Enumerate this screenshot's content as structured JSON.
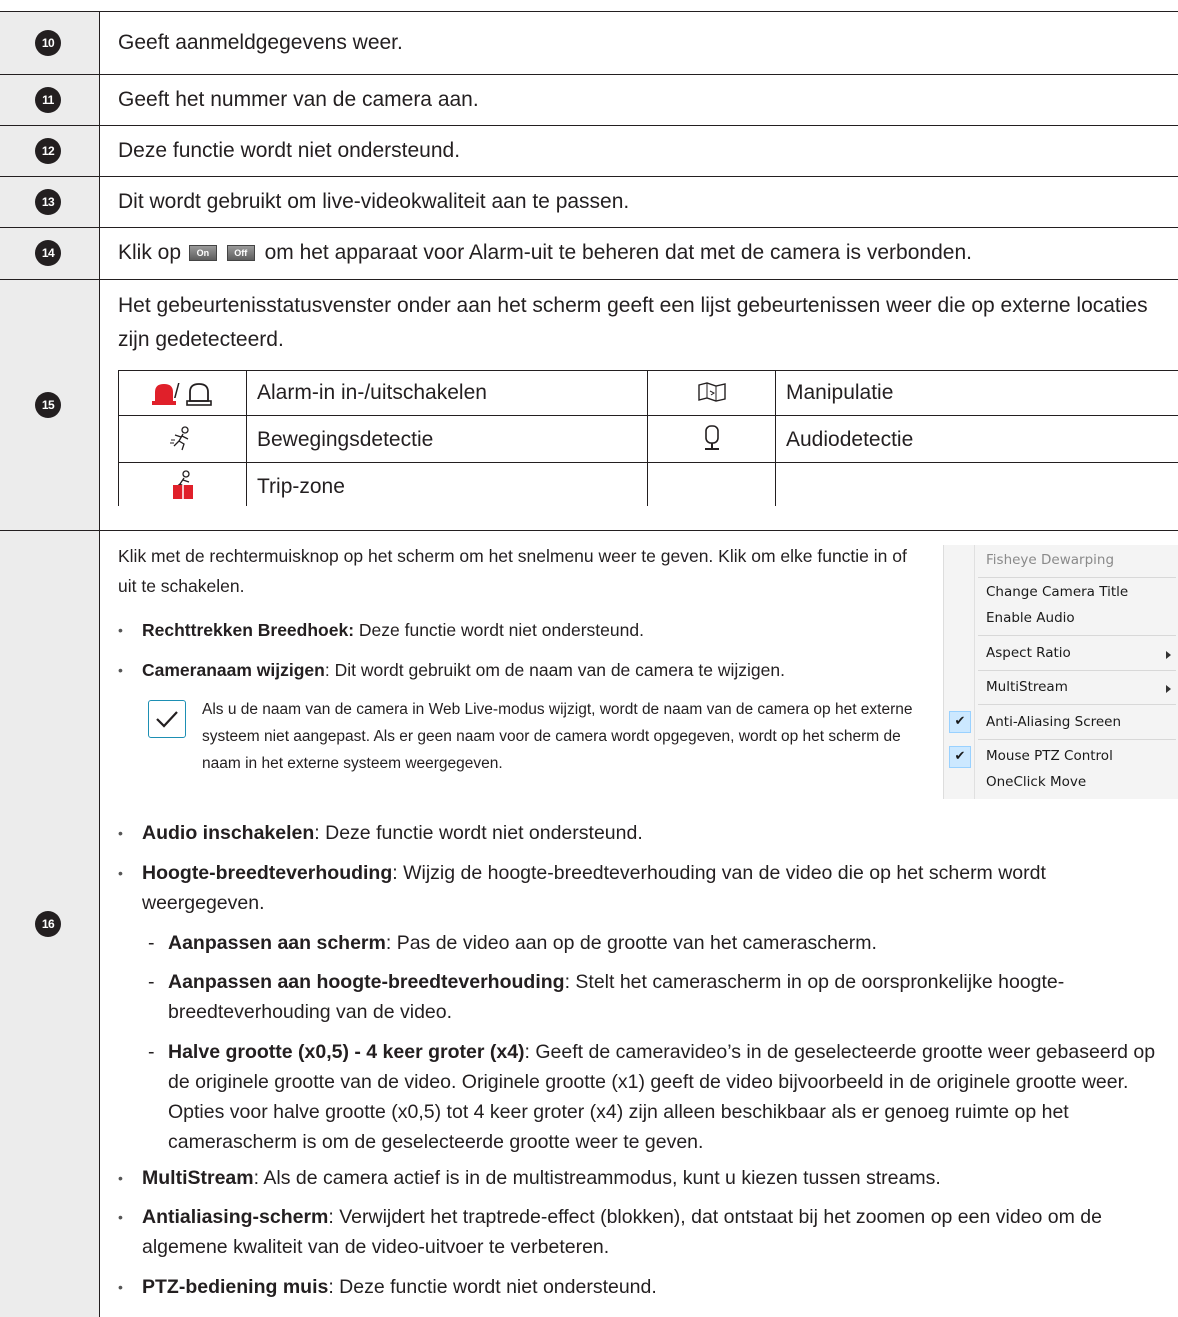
{
  "rows": [
    {
      "num": "10",
      "text": "Geeft aanmeldgegevens weer."
    },
    {
      "num": "11",
      "text": "Geeft het nummer van de camera aan."
    },
    {
      "num": "12",
      "text": "Deze functie wordt niet ondersteund."
    },
    {
      "num": "13",
      "text": "Dit wordt gebruikt om live-videokwaliteit aan te passen."
    }
  ],
  "row14": {
    "num": "14",
    "prefix": "Klik op",
    "on": "On",
    "off": "Off",
    "suffix": "om het apparaat voor Alarm-uit te beheren dat met de camera is verbonden."
  },
  "row15": {
    "num": "15",
    "intro": "Het gebeurtenisstatusvenster onder aan het scherm geeft een lijst gebeurtenissen weer die op externe locaties zijn gedetecteerd.",
    "events": [
      {
        "icon": "alarm-in-icon",
        "label": "Alarm-in in-/uitschakelen"
      },
      {
        "icon": "tampering-icon",
        "label": "Manipulatie"
      },
      {
        "icon": "motion-detection-icon",
        "label": "Bewegingsdetectie"
      },
      {
        "icon": "audio-detection-icon",
        "label": "Audiodetectie"
      },
      {
        "icon": "trip-zone-icon",
        "label": "Trip-zone"
      }
    ],
    "alarm_slash": "/"
  },
  "row16": {
    "num": "16",
    "intro": "Klik met de rechtermuisknop op het scherm om het snelmenu weer te geven. Klik om elke functie in of uit te schakelen.",
    "b1": {
      "bold": "Rechttrekken Breedhoek:",
      "text": " Deze functie wordt niet ondersteund."
    },
    "b2": {
      "bold": "Cameranaam wijzigen",
      "text": ": Dit wordt gebruikt om de naam van de camera te wijzigen."
    },
    "note": "Als u de naam van de camera in Web Live-modus wijzigt, wordt de naam van de camera op het externe systeem niet aangepast. Als er geen naam voor de camera wordt opgegeven, wordt op het scherm de naam in het externe systeem weergegeven.",
    "b3": {
      "bold": "Audio inschakelen",
      "text": ": Deze functie wordt niet ondersteund."
    },
    "b4": {
      "bold": "Hoogte-breedteverhouding",
      "text": ": Wijzig de hoogte-breedteverhouding van de video die op het scherm wordt weergegeven."
    },
    "s1": {
      "bold": "Aanpassen aan scherm",
      "text": ": Pas de video aan op de grootte van het camerascherm."
    },
    "s2": {
      "bold": "Aanpassen aan hoogte-breedteverhouding",
      "text": ": Stelt het camerascherm in op de oorspronkelijke hoogte-breedteverhouding van de video."
    },
    "s3": {
      "bold": "Halve grootte (x0,5) - 4 keer groter (x4)",
      "text": ": Geeft de cameravideo’s in de geselecteerde grootte weer gebaseerd op de originele grootte van de video. Originele grootte (x1) geeft de video bijvoorbeeld in de originele grootte weer. Opties voor halve grootte (x0,5) tot 4 keer groter (x4) zijn alleen beschikbaar als er genoeg ruimte op het camerascherm is om de geselecteerde grootte weer te geven."
    },
    "b5": {
      "bold": "MultiStream",
      "text": ": Als de camera actief is in de multistreammodus, kunt u kiezen tussen streams."
    },
    "b6": {
      "bold": "Antialiasing-scherm",
      "text": ": Verwijdert het traptrede-effect (blokken), dat ontstaat bij het zoomen op een video om de algemene kwaliteit van de video-uitvoer te verbeteren."
    },
    "b7": {
      "bold": "PTZ-bediening muis",
      "text": ": Deze functie wordt niet ondersteund."
    },
    "bullet": "•",
    "dash": "-",
    "check": "✔"
  },
  "context_menu": {
    "items": [
      "Fisheye Dewarping",
      "Change Camera Title",
      "Enable Audio",
      "Aspect Ratio",
      "MultiStream",
      "Anti-Aliasing Screen",
      "Mouse PTZ Control",
      "OneClick Move"
    ],
    "checked": [
      "Anti-Aliasing Screen",
      "Mouse PTZ Control"
    ],
    "disabled": [
      "Fisheye Dewarping"
    ]
  },
  "colors": {
    "alarm_red": "#e0202a",
    "check_blue": "#1d8fb3",
    "number_cell": "#ececec"
  }
}
